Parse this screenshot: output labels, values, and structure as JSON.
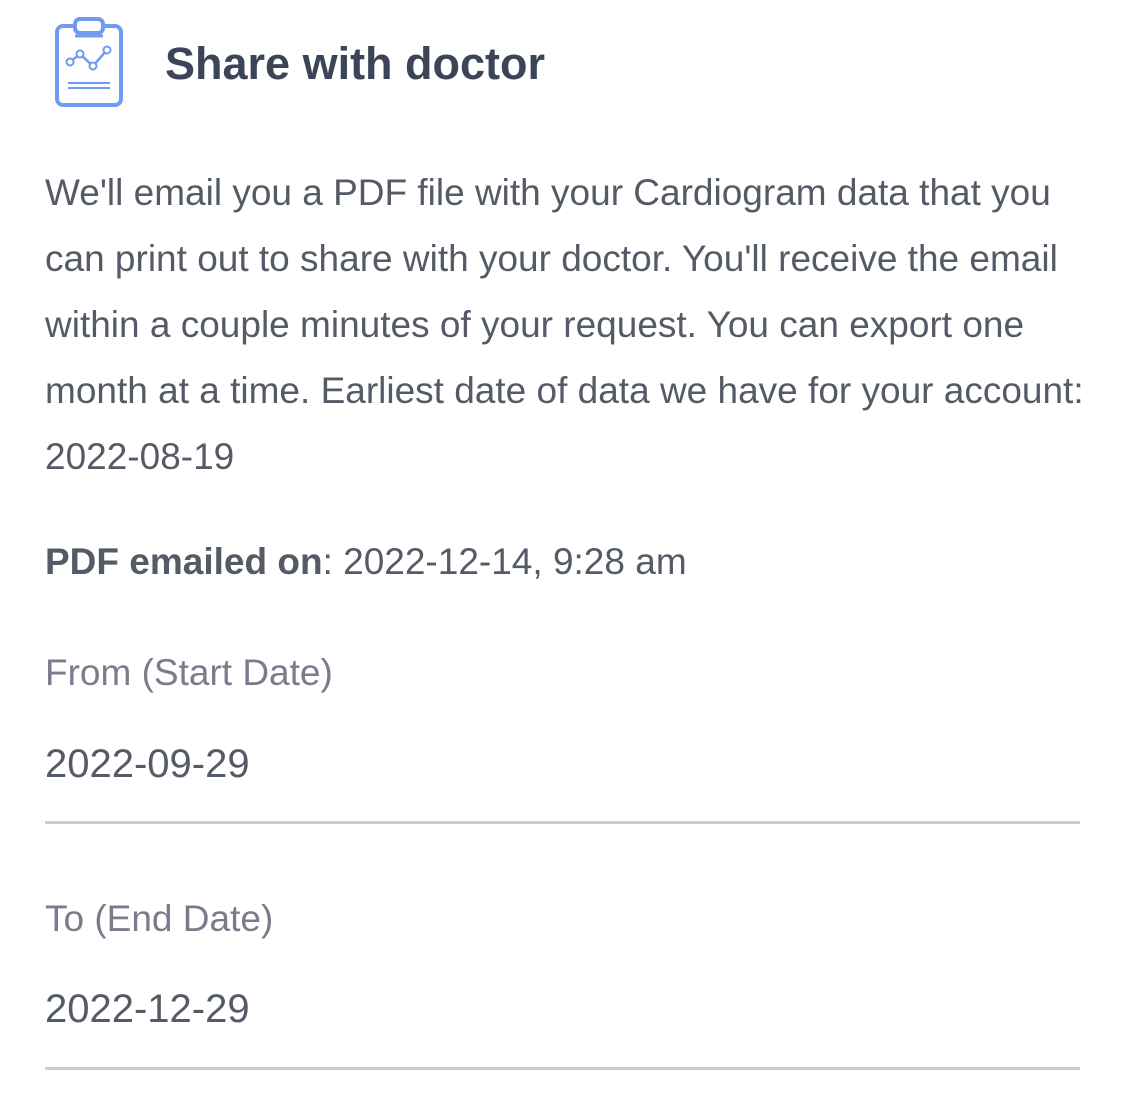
{
  "header": {
    "icon": "clipboard-chart-icon",
    "title": "Share with doctor"
  },
  "description": "We'll email you a PDF file with your Cardiogram data that you can print out to share with your doctor. You'll receive the email within a couple minutes of your request. You can export one month at a time. Earliest date of data we have for your account: 2022-08-19",
  "emailed": {
    "label": "PDF emailed on",
    "separator": ":",
    "value": " 2022-12-14, 9:28 am"
  },
  "start_date": {
    "label": "From (Start Date)",
    "value": "2022-09-29"
  },
  "end_date": {
    "label": "To (End Date)",
    "value": "2022-12-29"
  },
  "colors": {
    "icon_blue": "#6f9cf0",
    "title": "#3c4457",
    "body_text": "#555b66",
    "label_text": "#7d7a8c",
    "divider": "#c9ced8"
  }
}
